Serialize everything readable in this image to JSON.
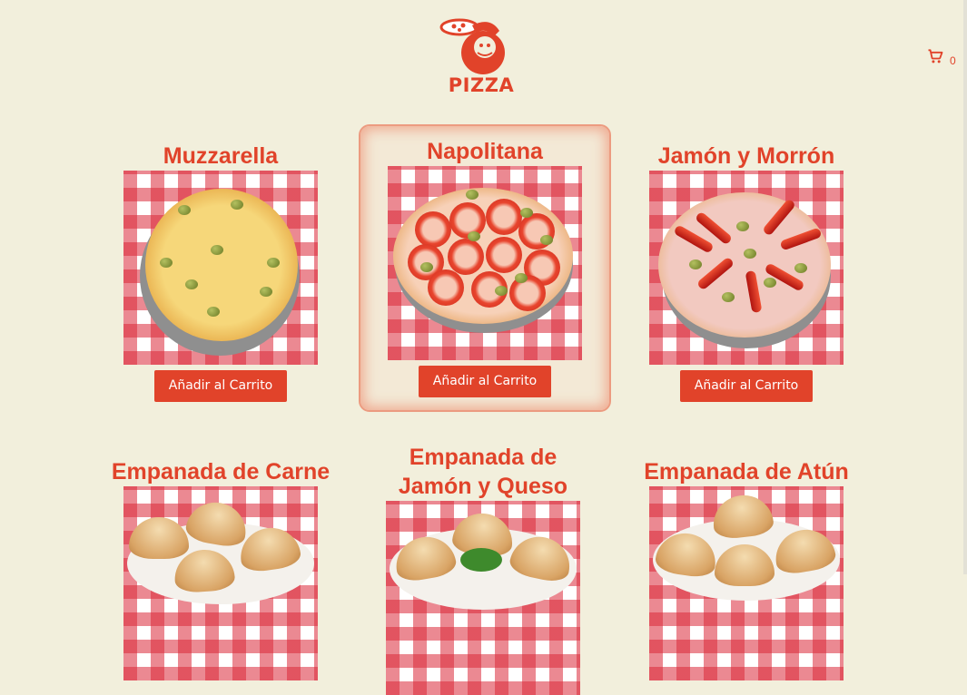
{
  "header": {
    "logo_text": "PIZZA",
    "cart_count": "0"
  },
  "products": [
    {
      "title": "Muzzarella",
      "button": "Añadir al Carrito"
    },
    {
      "title": "Napolitana",
      "button": "Añadir al Carrito"
    },
    {
      "title": "Jamón y Morrón",
      "button": "Añadir al Carrito"
    },
    {
      "title": "Empanada de Carne"
    },
    {
      "title_line1": "Empanada de",
      "title_line2": "Jamón y Queso"
    },
    {
      "title": "Empanada de Atún"
    }
  ],
  "colors": {
    "accent": "#e1432a",
    "background": "#f2efdc",
    "featured_border": "#ec9b80",
    "tablecloth_red": "#db2838"
  },
  "icons": {
    "logo": "pizza-chef-logo",
    "cart": "shopping-cart-icon"
  }
}
